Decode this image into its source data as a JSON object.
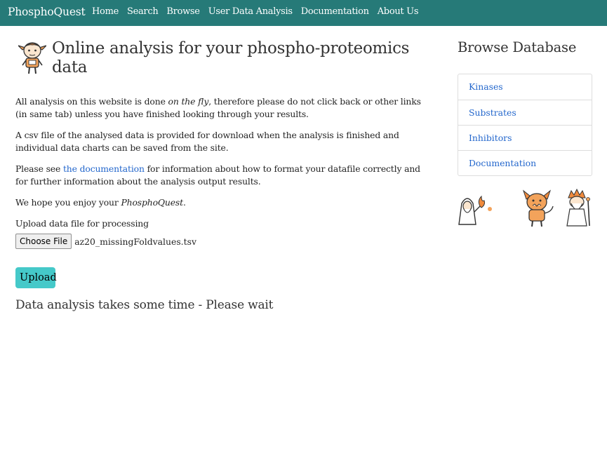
{
  "nav": {
    "brand": "PhosphoQuest",
    "items": [
      "Home",
      "Search",
      "Browse",
      "User Data Analysis",
      "Documentation",
      "About Us"
    ]
  },
  "main": {
    "title": "Online analysis for your phospho-proteomics data",
    "p1_a": "All analysis on this website is done ",
    "p1_em": "on the fly",
    "p1_b": ", therefore please do not click back or other links (in same tab) unless you have finished looking through your results.",
    "p2": "A csv file of the analysed data is provided for download when the analysis is finished and individual data charts can be saved from the site.",
    "p3_a": "Please see ",
    "p3_link": "the documentation",
    "p3_b": " for information about how to format your datafile correctly and for further information about the analysis output results.",
    "p4_a": "We hope you enjoy your ",
    "p4_em": "PhosphoQuest",
    "p4_b": ".",
    "upload_label": "Upload data file for processing",
    "choose_file": "Choose File",
    "file_name": "az20_missingFoldvalues.tsv",
    "upload_button": "Upload",
    "wait_message": "Data analysis takes some time - Please wait"
  },
  "sidebar": {
    "title": "Browse Database",
    "items": [
      "Kinases",
      "Substrates",
      "Inhibitors",
      "Documentation"
    ]
  },
  "colors": {
    "navbar": "#267a78",
    "link": "#2266cc",
    "upload_button": "#45c9c9"
  }
}
